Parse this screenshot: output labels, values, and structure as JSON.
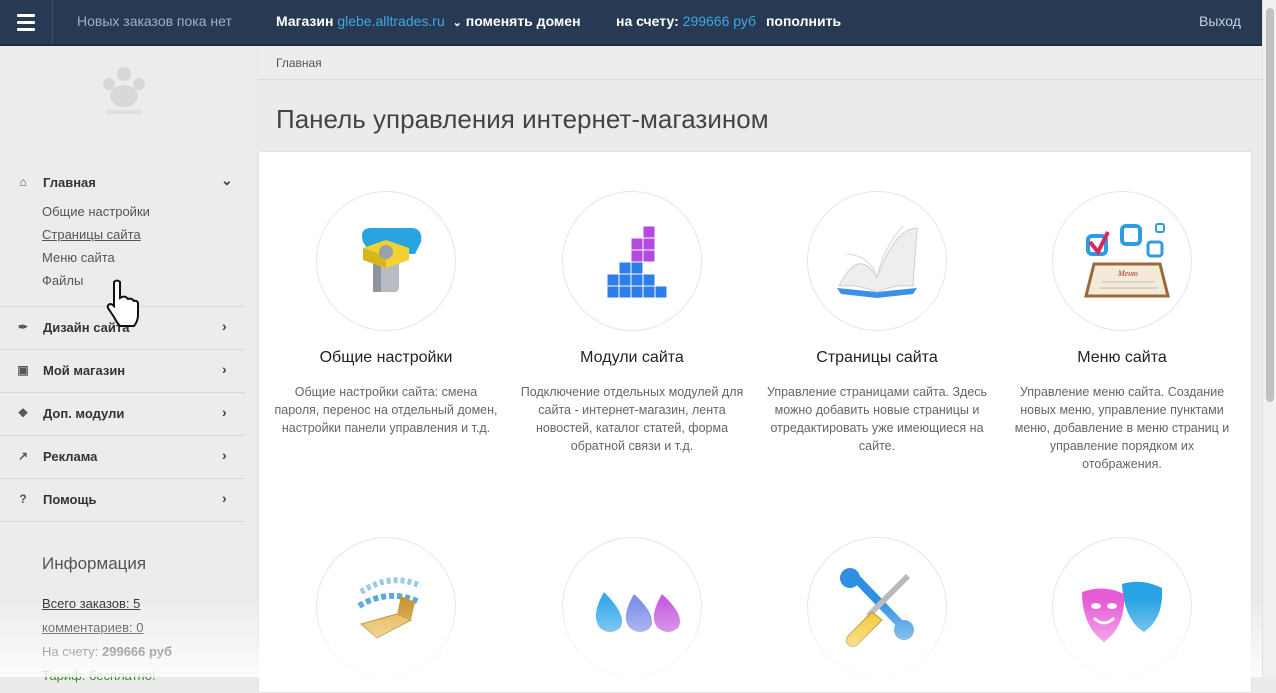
{
  "topbar": {
    "orders_text": "Новых заказов пока нет",
    "shop_label": "Магазин",
    "shop_domain": "glebe.alltrades.ru",
    "change_domain": "поменять домен",
    "balance_label": "на счету:",
    "balance_amount": "299666 руб",
    "topup": "пополнить",
    "logout": "Выход"
  },
  "sidebar": {
    "logo_icon": "paw-logo-icon",
    "home": {
      "label": "Главная",
      "subitems": [
        "Общие настройки",
        "Страницы сайта",
        "Меню сайта",
        "Файлы"
      ]
    },
    "items": [
      {
        "label": "Дизайн сайта",
        "icon": "brush-icon"
      },
      {
        "label": "Мой магазин",
        "icon": "cart-icon"
      },
      {
        "label": "Доп. модули",
        "icon": "cubes-icon"
      },
      {
        "label": "Реклама",
        "icon": "chart-icon"
      },
      {
        "label": "Помощь",
        "icon": "help-icon"
      }
    ],
    "info": {
      "title": "Информация",
      "orders": "Всего заказов: 5",
      "comments": "комментариев: 0",
      "balance_label": "На счету:",
      "balance_value": "299666 руб",
      "tariff": "Тариф: бесплатно!"
    }
  },
  "breadcrumb": "Главная",
  "page_title": "Панель управления интернет-магазином",
  "cards": [
    {
      "name": "Общие настройки",
      "icon": "wrench-bolt-icon",
      "desc": "Общие настройки сайта: смена пароля, перенос на отдельный домен, настройки панели управления и т.д."
    },
    {
      "name": "Модули сайта",
      "icon": "blocks-icon",
      "desc": "Подключение отдельных модулей для сайта - интернет-магазин, лента новостей, каталог статей, форма обратной связи и т.д."
    },
    {
      "name": "Страницы сайта",
      "icon": "open-book-icon",
      "desc": "Управление страницами сайта. Здесь можно добавить новые страницы и отредактировать уже имеющиеся на сайте."
    },
    {
      "name": "Меню сайта",
      "icon": "menu-checkbox-icon",
      "desc": "Управление меню сайта. Создание новых меню, управление пунктами меню, добавление в меню страниц и управление порядком их отображения."
    }
  ],
  "cards_row2_icons": [
    "binary-box-icon",
    "drops-icon",
    "tools-icon",
    "masks-icon"
  ],
  "menu_icon_word": "Меню"
}
